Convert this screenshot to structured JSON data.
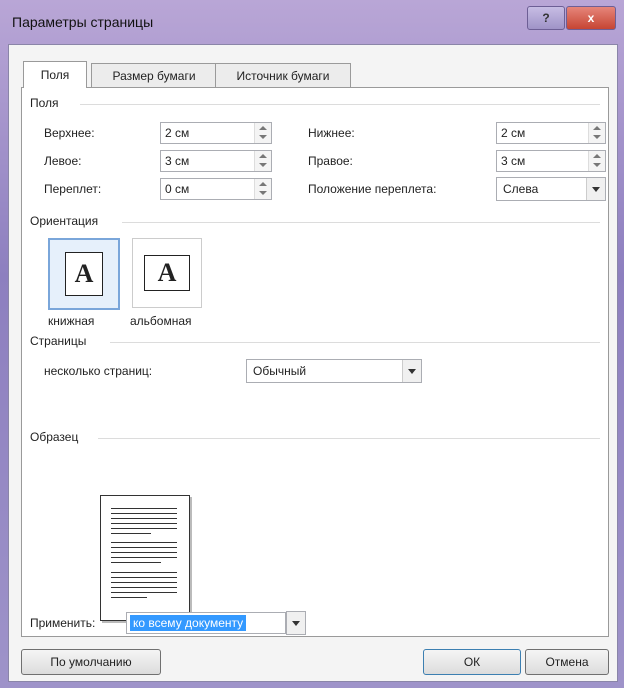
{
  "window": {
    "title": "Параметры страницы",
    "help_label": "?",
    "close_label": "x"
  },
  "tabs": [
    {
      "label": "Поля",
      "active": true
    },
    {
      "label": "Размер бумаги",
      "active": false
    },
    {
      "label": "Источник бумаги",
      "active": false
    }
  ],
  "margins": {
    "group_label": "Поля",
    "top": {
      "label": "Верхнее:",
      "value": "2 см"
    },
    "bottom": {
      "label": "Нижнее:",
      "value": "2 см"
    },
    "left": {
      "label": "Левое:",
      "value": "3 см"
    },
    "right": {
      "label": "Правое:",
      "value": "3 см"
    },
    "gutter": {
      "label": "Переплет:",
      "value": "0 см"
    },
    "gutter_position": {
      "label": "Положение переплета:",
      "value": "Слева"
    }
  },
  "orientation": {
    "group_label": "Ориентация",
    "portrait": {
      "label": "книжная",
      "glyph": "A",
      "selected": true
    },
    "landscape": {
      "label": "альбомная",
      "glyph": "A",
      "selected": false
    }
  },
  "pages": {
    "group_label": "Страницы",
    "multiple_label": "несколько страниц:",
    "multiple_value": "Обычный"
  },
  "sample": {
    "group_label": "Образец"
  },
  "apply": {
    "label": "Применить:",
    "value": "ко всему документу"
  },
  "buttons": {
    "default_label": "По умолчанию",
    "ok_label": "ОК",
    "cancel_label": "Отмена"
  },
  "colors": {
    "accent": "#3399ff",
    "title_bar": "#9e93c9",
    "close": "#c64533"
  }
}
